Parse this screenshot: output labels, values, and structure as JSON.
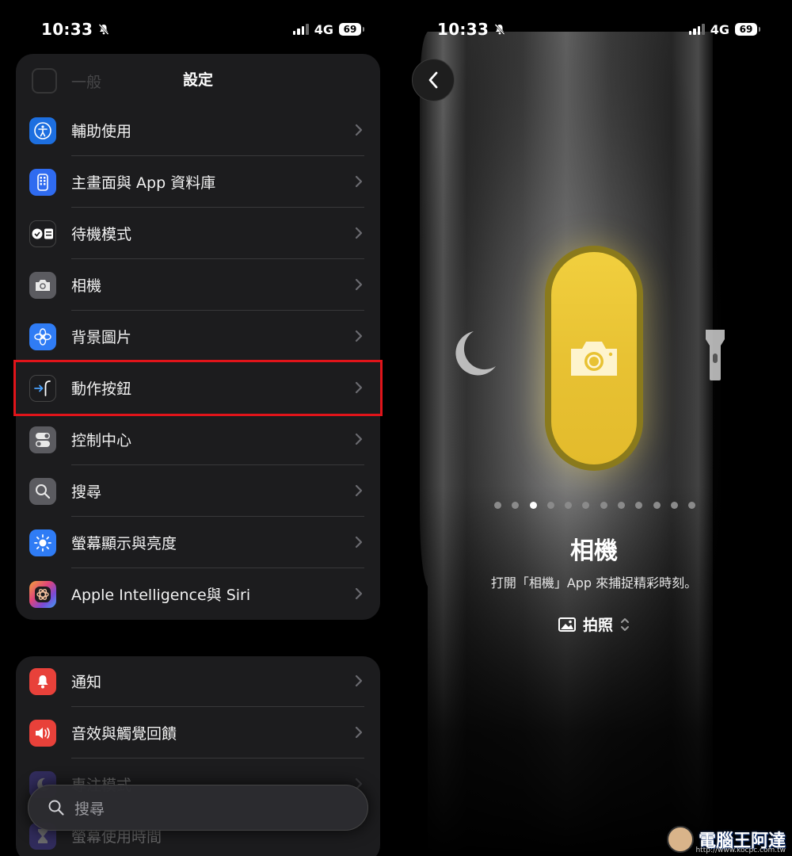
{
  "left": {
    "status": {
      "time": "10:33",
      "network": "4G",
      "battery": "69"
    },
    "nav_title": "設定",
    "ghost_row": "一般",
    "rows": [
      {
        "label": "輔助使用",
        "icon": "accessibility-icon",
        "color": "#1d6fe0"
      },
      {
        "label": "主畫面與 App 資料庫",
        "icon": "home-screen-icon",
        "color": "#2f6bf0"
      },
      {
        "label": "待機模式",
        "icon": "standby-icon",
        "color": "#1c1c1e"
      },
      {
        "label": "相機",
        "icon": "camera-icon",
        "color": "#5b5b60"
      },
      {
        "label": "背景圖片",
        "icon": "wallpaper-icon",
        "color": "#2f7cf5"
      },
      {
        "label": "動作按鈕",
        "icon": "action-button-icon",
        "color": "#2a6fe8"
      },
      {
        "label": "控制中心",
        "icon": "control-center-icon",
        "color": "#5b5b60"
      },
      {
        "label": "搜尋",
        "icon": "search-icon",
        "color": "#5b5b60"
      },
      {
        "label": "螢幕顯示與亮度",
        "icon": "brightness-icon",
        "color": "#2f7cf5"
      },
      {
        "label": "Apple Intelligence與 Siri",
        "icon": "apple-intelligence-icon",
        "color": "#7a4bd6"
      }
    ],
    "rows2": [
      {
        "label": "通知",
        "icon": "notification-bell-icon",
        "color": "#e8413a"
      },
      {
        "label": "音效與觸覺回饋",
        "icon": "sound-icon",
        "color": "#e8413a"
      },
      {
        "label": "專注模式",
        "icon": "focus-moon-icon",
        "color": "#5a4ad1"
      },
      {
        "label": "螢幕使用時間",
        "icon": "screen-time-icon",
        "color": "#5a4ad1"
      }
    ],
    "search_placeholder": "搜尋",
    "highlight_color": "#e0141a"
  },
  "right": {
    "status": {
      "time": "10:33",
      "network": "4G",
      "battery": "69"
    },
    "title": "相機",
    "description": "打開「相機」App 來捕捉精彩時刻。",
    "mode_label": "拍照",
    "page_count": 12,
    "active_page": 2,
    "accent_color": "#e9c334",
    "watermark": "電腦王阿達",
    "watermark_url": "http://www.kocpc.com.tw"
  }
}
